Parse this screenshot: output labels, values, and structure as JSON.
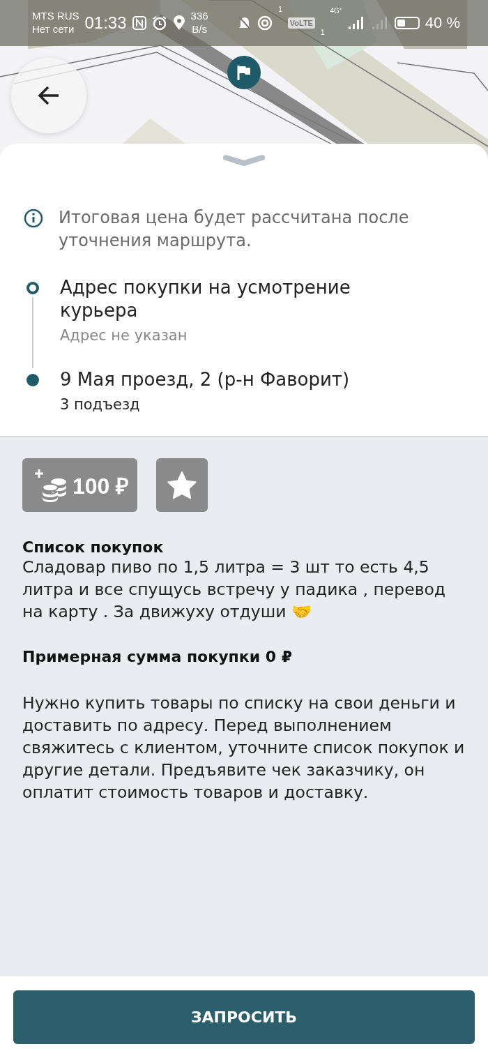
{
  "status_bar": {
    "carrier": "MTS RUS",
    "network": "Нет сети",
    "time": "01:33",
    "speed_value": "336",
    "speed_unit": "B/s",
    "hotspot_sup": "1",
    "volte": "VoLTE",
    "volte_sub": "1",
    "net_type": "4G⁺",
    "battery": "40 %"
  },
  "info_note": "Итоговая цена будет рассчитана после уточнения маршрута.",
  "route": [
    {
      "kind": "start",
      "title": "Адрес покупки на усмотрение курьера",
      "subtitle": "Адрес не указан"
    },
    {
      "kind": "end",
      "title": "9 Мая проезд, 2 (р-н Фаворит)",
      "subtitle": "3 подъезд"
    }
  ],
  "bonus": {
    "amount": "100 ₽"
  },
  "favorite": {
    "selected": false
  },
  "shopping_list": {
    "title": "Список покупок",
    "text": "Сладовар пиво по 1,5 литра = 3 шт то есть 4,5 литра и все спущусь встречу у падика , перевод на карту . За движуху отдуши 🤝"
  },
  "estimated_sum": "Примерная сумма покупки 0 ₽",
  "instructions": "Нужно купить товары по списку на свои деньги и доставить по адресу. Перед выполнением свяжитесь с клиентом, уточните список покупок и другие детали. Предъявите чек заказчику, он оплатит стоимость товаров и доставку.",
  "action_button": "ЗАПРОСИТЬ"
}
